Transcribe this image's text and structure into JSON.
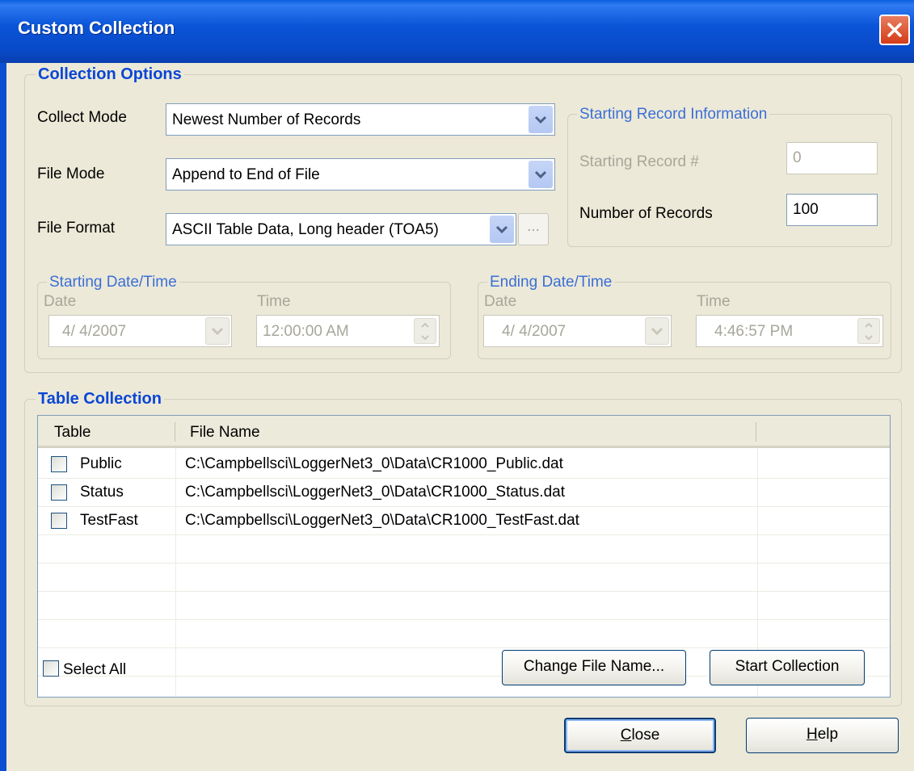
{
  "window": {
    "title": "Custom Collection"
  },
  "collection_options": {
    "legend": "Collection Options",
    "collect_mode": {
      "label": "Collect Mode",
      "value": "Newest Number of Records"
    },
    "file_mode": {
      "label": "File Mode",
      "value": "Append to End of File"
    },
    "file_format": {
      "label": "File Format",
      "value": "ASCII Table Data, Long header (TOA5)",
      "browse_label": "..."
    },
    "starting_record_info": {
      "legend": "Starting Record Information",
      "starting_record_label": "Starting Record #",
      "starting_record_value": "0",
      "number_of_records_label": "Number of Records",
      "number_of_records_value": "100"
    },
    "starting_datetime": {
      "legend": "Starting Date/Time",
      "date_label": "Date",
      "date_value": "4/  4/2007",
      "time_label": "Time",
      "time_value": "12:00:00 AM"
    },
    "ending_datetime": {
      "legend": "Ending Date/Time",
      "date_label": "Date",
      "date_value": "4/  4/2007",
      "time_label": "Time",
      "time_value": "4:46:57 PM"
    }
  },
  "table_collection": {
    "legend": "Table Collection",
    "columns": [
      "Table",
      "File Name"
    ],
    "rows": [
      {
        "table": "Public",
        "file": "C:\\Campbellsci\\LoggerNet3_0\\Data\\CR1000_Public.dat",
        "checked": false
      },
      {
        "table": "Status",
        "file": "C:\\Campbellsci\\LoggerNet3_0\\Data\\CR1000_Status.dat",
        "checked": false
      },
      {
        "table": "TestFast",
        "file": "C:\\Campbellsci\\LoggerNet3_0\\Data\\CR1000_TestFast.dat",
        "checked": false
      }
    ],
    "select_all_label": "Select All",
    "change_file_name_label": "Change File Name...",
    "start_collection_label": "Start Collection"
  },
  "footer": {
    "close_label": "Close",
    "help_label": "Help"
  },
  "colors": {
    "title_bar": "#0a55d8",
    "group_legend": "#0a46d5",
    "dialog_bg": "#ece9d8"
  }
}
